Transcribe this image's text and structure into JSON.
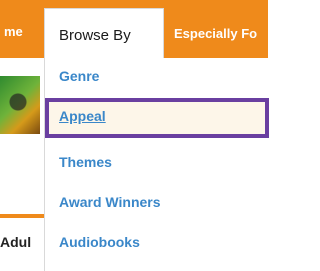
{
  "nav": {
    "tab_left_label": "me",
    "tab_active_label": "Browse By",
    "tab_right_label": "Especially Fo"
  },
  "menu": {
    "items": [
      {
        "label": "Genre"
      },
      {
        "label": "Appeal"
      },
      {
        "label": "Themes"
      },
      {
        "label": "Award Winners"
      },
      {
        "label": "Audiobooks"
      }
    ]
  },
  "background": {
    "partial_text": "Adul"
  },
  "colors": {
    "accent_orange": "#ef8a1b",
    "link_blue": "#3a87c9",
    "highlight_border": "#6a3fa0",
    "highlight_fill": "#fdf6e9"
  }
}
